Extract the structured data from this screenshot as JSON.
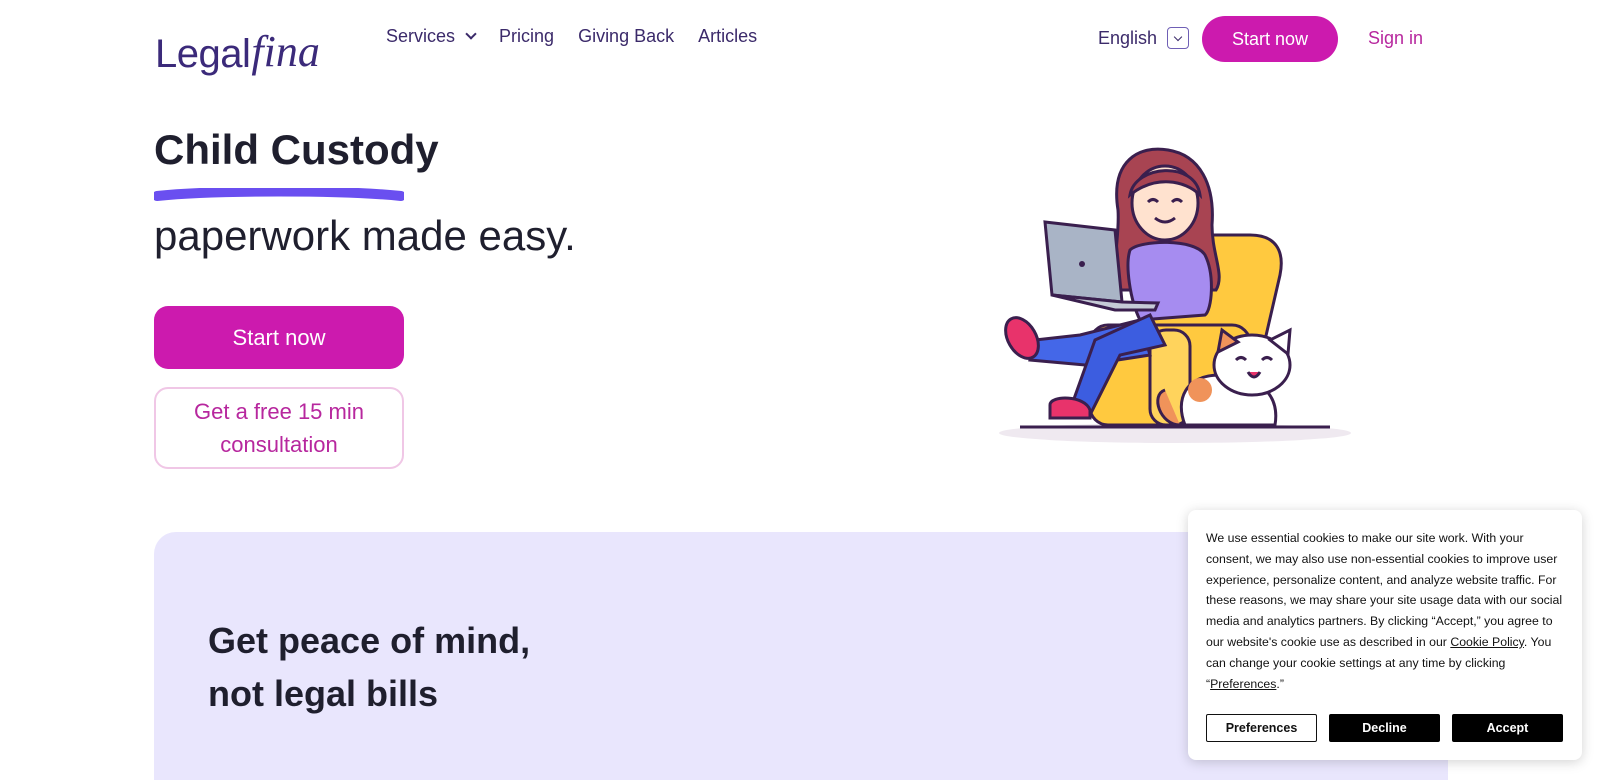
{
  "logo": {
    "part1": "Legal",
    "part2": "fina"
  },
  "nav": {
    "items": [
      {
        "label": "Services"
      },
      {
        "label": "Pricing"
      },
      {
        "label": "Giving Back"
      },
      {
        "label": "Articles"
      }
    ]
  },
  "header": {
    "language": "English",
    "start_label": "Start now",
    "signin_label": "Sign in"
  },
  "hero": {
    "title": "Child Custody",
    "subtitle": "paperwork made easy.",
    "start_label": "Start now",
    "consult_label": "Get a free 15 min consultation"
  },
  "section": {
    "title_line1": "Get peace of mind,",
    "title_line2": "not legal bills"
  },
  "cookie": {
    "text_part1": "We use essential cookies to make our site work. With your consent, we may also use non-essential cookies to improve user experience, personalize content, and analyze website traffic. For these reasons, we may share your site usage data with our social media and analytics partners. By clicking “Accept,” you agree to our website's cookie use as described in our ",
    "policy_link": "Cookie Policy",
    "text_part2": ". You can change your cookie settings at any time by clicking “",
    "preferences_link": "Preferences",
    "text_part3": ".”",
    "preferences_button": "Preferences",
    "decline_button": "Decline",
    "accept_button": "Accept"
  },
  "colors": {
    "brand_magenta": "#cc1aae",
    "brand_purple": "#3b2a7a",
    "underline": "#6a4ff0",
    "section_bg": "#e9e6fd"
  }
}
